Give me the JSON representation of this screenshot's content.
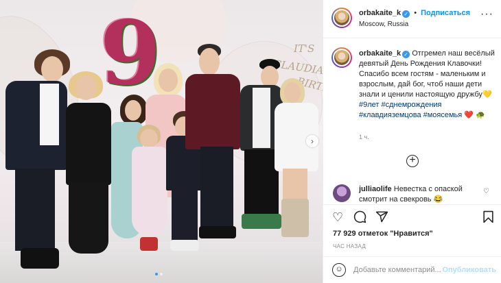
{
  "photo": {
    "wall_text_1": "IT'S",
    "wall_text_2": "CLAUDIA'S",
    "wall_text_3": "BIRTHDA",
    "number": "9",
    "nav_next_icon": "chevron-right-icon",
    "slide_count": 2,
    "active_slide": 1
  },
  "header": {
    "username": "orbakaite_k",
    "verified_icon": "verified-check-icon",
    "separator": "•",
    "follow_label": "Подписаться",
    "location": "Moscow, Russia",
    "more_icon": "more-options-icon"
  },
  "caption": {
    "username": "orbakaite_k",
    "text": "Отгремел наш весёлый девятый День Рождения Клавочки! Спасибо всем гостям - маленьким и взрослым, дай бог, чтоб наши дети знали и ценили настоящую дружбу",
    "emoji_1": "💛",
    "hashtags": [
      "#9лет",
      "#сднемрождения",
      "#клавдияземцова",
      "#моясемья"
    ],
    "emoji_2": "❤️",
    "emoji_3": "🐢",
    "time": "1 ч."
  },
  "load_more_icon": "plus-circle-icon",
  "comment": {
    "username": "julliaolife",
    "text": "Невестка с опаской смотрит на свекровь",
    "emoji": "😂",
    "like_icon": "heart-outline-icon"
  },
  "actions": {
    "like_icon": "heart-outline-icon",
    "comment_icon": "comment-bubble-icon",
    "share_icon": "paper-plane-icon",
    "save_icon": "bookmark-icon",
    "likes_count": "77 929",
    "likes_text": "отметок",
    "likes_suffix": "\"Нравится\"",
    "posted_ago": "ЧАС НАЗАД"
  },
  "add_comment": {
    "emoji_icon": "smiley-icon",
    "placeholder": "Добавьте комментарий...",
    "publish_label": "Опубликовать"
  },
  "colors": {
    "accent": "#0095f6",
    "publish_disabled": "#b2dffc",
    "hashtag": "#00376b",
    "muted": "#8e8e8e"
  }
}
